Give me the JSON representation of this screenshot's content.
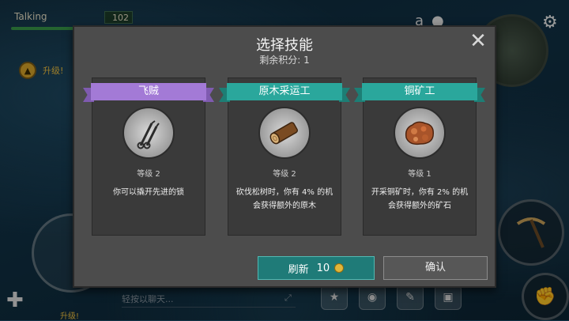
{
  "hud": {
    "status_name": "Talking",
    "status_value": "102",
    "levelup_label": "升级!",
    "chat_placeholder": "轻按以聊天..."
  },
  "dialog": {
    "title": "选择技能",
    "remaining_points": "剩余积分:  1",
    "cards": [
      {
        "name": "飞贼",
        "level": "等级 2",
        "description": "你可以撬开先进的锁",
        "ribbon_color": "#a37ad6",
        "icon": "lockpick-icon"
      },
      {
        "name": "原木采运工",
        "level": "等级 2",
        "description": "砍伐松树时，你有 4% 的机会获得额外的原木",
        "ribbon_color": "#2aa79c",
        "icon": "log-icon"
      },
      {
        "name": "铜矿工",
        "level": "等级 1",
        "description": "开采铜矿时，你有 2% 的机会获得额外的矿石",
        "ribbon_color": "#2aa79c",
        "icon": "copper-ore-icon"
      }
    ],
    "refresh_label": "刷新",
    "refresh_cost": "10",
    "confirm_label": "确认"
  }
}
